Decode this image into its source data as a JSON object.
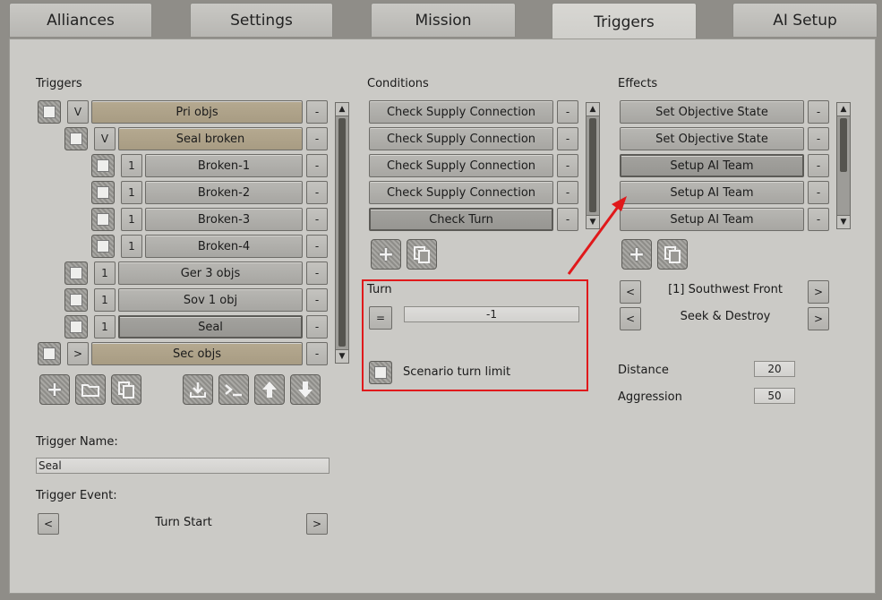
{
  "tabs": [
    {
      "label": "Alliances"
    },
    {
      "label": "Settings"
    },
    {
      "label": "Mission"
    },
    {
      "label": "Triggers",
      "active": true
    },
    {
      "label": "AI Setup"
    }
  ],
  "triggers": {
    "heading": "Triggers",
    "rows": [
      {
        "label": "Pri objs",
        "toggle": "V",
        "style": "tan",
        "minus": "-"
      },
      {
        "label": "Seal broken",
        "toggle": "V",
        "style": "tan",
        "minus": "-"
      },
      {
        "label": "Broken-1",
        "toggle": "1",
        "style": "gray",
        "minus": "-"
      },
      {
        "label": "Broken-2",
        "toggle": "1",
        "style": "gray",
        "minus": "-"
      },
      {
        "label": "Broken-3",
        "toggle": "1",
        "style": "gray",
        "minus": "-"
      },
      {
        "label": "Broken-4",
        "toggle": "1",
        "style": "gray",
        "minus": "-"
      },
      {
        "label": "Ger 3 objs",
        "toggle": "1",
        "style": "gray",
        "minus": "-"
      },
      {
        "label": "Sov 1 obj",
        "toggle": "1",
        "style": "gray",
        "minus": "-"
      },
      {
        "label": "Seal",
        "toggle": "1",
        "style": "dark",
        "minus": "-"
      },
      {
        "label": "Sec objs",
        "toggle": ">",
        "style": "tan",
        "minus": "-"
      }
    ],
    "toolbar_icons": [
      "plus-icon",
      "folder-icon",
      "copy-icon",
      "import-icon",
      "console-icon",
      "arrow-up-icon",
      "arrow-down-icon"
    ]
  },
  "conditions": {
    "heading": "Conditions",
    "rows": [
      {
        "label": "Check Supply Connection",
        "minus": "-"
      },
      {
        "label": "Check Supply Connection",
        "minus": "-"
      },
      {
        "label": "Check Supply Connection",
        "minus": "-"
      },
      {
        "label": "Check Supply Connection",
        "minus": "-"
      },
      {
        "label": "Check Turn",
        "minus": "-",
        "selected": true
      }
    ],
    "turn": {
      "heading": "Turn",
      "operator": "=",
      "value": "-1",
      "scenario_limit_label": "Scenario turn limit"
    }
  },
  "effects": {
    "heading": "Effects",
    "rows": [
      {
        "label": "Set Objective State",
        "minus": "-"
      },
      {
        "label": "Set Objective State",
        "minus": "-"
      },
      {
        "label": "Setup AI Team",
        "minus": "-",
        "selected": true
      },
      {
        "label": "Setup AI Team",
        "minus": "-"
      },
      {
        "label": "Setup AI Team",
        "minus": "-"
      }
    ],
    "team_selector": {
      "prev": "<",
      "value": "[1] Southwest Front",
      "next": ">"
    },
    "mode_selector": {
      "prev": "<",
      "value": "Seek & Destroy",
      "next": ">"
    },
    "distance": {
      "label": "Distance",
      "value": "20"
    },
    "aggression": {
      "label": "Aggression",
      "value": "50"
    }
  },
  "trigger_name": {
    "label": "Trigger Name:",
    "value": "Seal"
  },
  "trigger_event": {
    "label": "Trigger Event:",
    "prev": "<",
    "value": "Turn Start",
    "next": ">"
  },
  "colors": {
    "annotation_red": "#e0191b",
    "tan_row": "#b5a990"
  }
}
